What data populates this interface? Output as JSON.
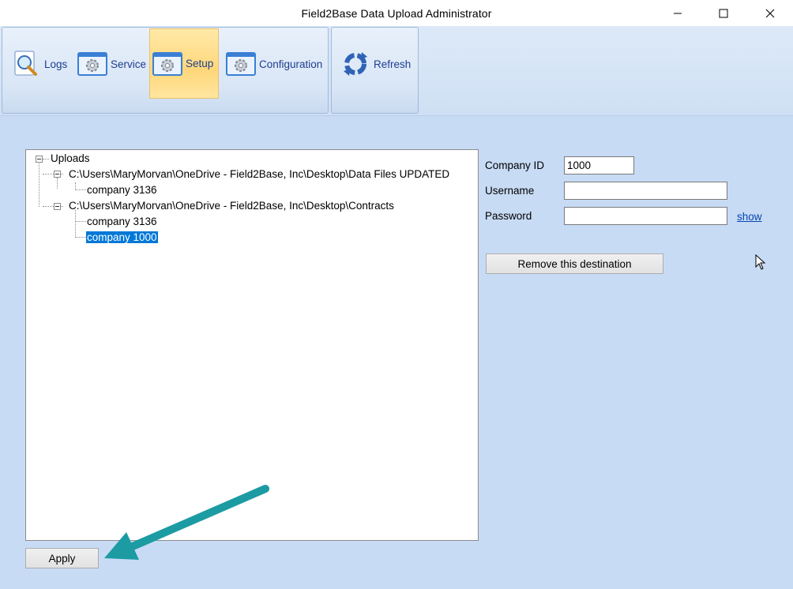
{
  "window": {
    "title": "Field2Base Data Upload Administrator",
    "controls": [
      "minimize-icon",
      "maximize-icon",
      "close-icon"
    ]
  },
  "ribbon": {
    "buttons": [
      {
        "label": "Logs",
        "icon": "magnifier-document-icon"
      },
      {
        "label": "Service",
        "icon": "gear-window-icon"
      },
      {
        "label": "Setup",
        "icon": "gear-window-icon",
        "active": true
      },
      {
        "label": "Configuration",
        "icon": "gear-window-icon"
      },
      {
        "label": "Refresh",
        "icon": "refresh-arrows-icon"
      }
    ]
  },
  "tree": {
    "root": "Uploads",
    "folders": [
      {
        "path": "C:\\Users\\MaryMorvan\\OneDrive - Field2Base, Inc\\Desktop\\Data Files UPDATED",
        "children": [
          "company 3136"
        ]
      },
      {
        "path": "C:\\Users\\MaryMorvan\\OneDrive - Field2Base, Inc\\Desktop\\Contracts",
        "children": [
          "company 3136",
          "company 1000"
        ]
      }
    ],
    "selected": "company 1000"
  },
  "form": {
    "company_id_label": "Company ID",
    "company_id_value": "1000",
    "username_label": "Username",
    "username_value": "",
    "password_label": "Password",
    "password_value": "",
    "show_link": "show",
    "remove_button": "Remove this destination"
  },
  "footer": {
    "apply_button": "Apply"
  },
  "colors": {
    "background": "#c7dbf5",
    "active_tab": "#ffd77a",
    "selection": "#0078d7",
    "annotation_arrow": "#1c9ba3"
  }
}
